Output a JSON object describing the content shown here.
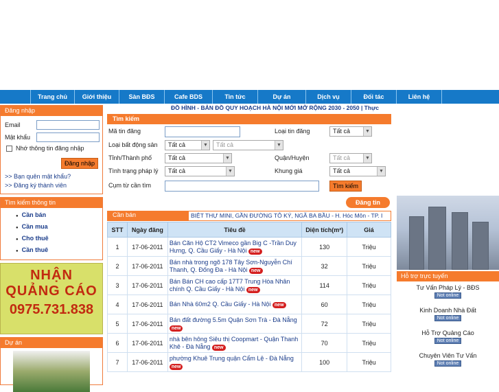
{
  "nav": [
    "Trang chủ",
    "Giới thiệu",
    "Sàn BĐS",
    "Cafe BDS",
    "Tin tức",
    "Dự án",
    "Dịch vụ",
    "Đối tác",
    "Liên hệ"
  ],
  "login": {
    "header": "Đăng nhập",
    "email_label": "Email",
    "password_label": "Mật khẩu",
    "remember_label": "Nhớ thông tin đăng nhập",
    "submit_label": "Đăng nhập",
    "forgot_link": ">> Bạn quên mật khẩu?",
    "register_link": ">> Đăng ký thành viên"
  },
  "search_info": {
    "header": "Tìm kiếm thông tin",
    "items": [
      "Cần bán",
      "Cần mua",
      "Cho thuê",
      "Cần thuê"
    ]
  },
  "ad": {
    "line1": "NHẬN",
    "line2": "QUẢNG CÁO",
    "phone": "0975.731.838"
  },
  "project_box": {
    "header": "Dự án"
  },
  "marquee": "ĐỒ HÌNH - BẢN ĐỒ QUY HOẠCH HÀ NỘI MỚI MỞ RỘNG 2030 - 2050 | Thực",
  "search": {
    "header": "Tìm kiếm",
    "code_label": "Mã tin đăng",
    "type_label": "Loại tin đăng",
    "type_value": "Tất cả",
    "property_label": "Loại bất động sản",
    "property_value": "Tất cả",
    "property_sub_value": "Tất cả",
    "province_label": "Tỉnh/Thành phố",
    "province_value": "Tất cả",
    "district_label": "Quận/Huyện",
    "district_value": "Tất cả",
    "legal_label": "Tình trạng pháp lý",
    "legal_value": "Tất cả",
    "price_label": "Khung giá",
    "price_value": "Tất cả",
    "keyword_label": "Cụm từ cần tìm",
    "search_button": "Tìm kiếm",
    "post_button": "Đăng tin"
  },
  "listing": {
    "tag": "Cần bán",
    "ticker": "BIỆT THỰ MINI, GẦN ĐƯỜNG TÔ KÝ, NGÃ BA BẦU - H. Hóc Môn - TP. I",
    "columns": [
      "STT",
      "Ngày đăng",
      "Tiêu đề",
      "Diện tích(m²)",
      "Giá"
    ],
    "new_badge": "new",
    "rows": [
      {
        "stt": "1",
        "date": "17-06-2011",
        "title": "Bán Căn Hộ CT2 Vimeco gần Big C -Trần Duy Hưng, Q. Cầu Giấy - Hà Nội",
        "area": "130",
        "price": "Triệu"
      },
      {
        "stt": "2",
        "date": "17-06-2011",
        "title": "Bán nhà trong ngõ 178 Tây Sơn-Nguyễn Chí Thanh, Q. Đống Đa - Hà Nội",
        "area": "32",
        "price": "Triệu"
      },
      {
        "stt": "3",
        "date": "17-06-2011",
        "title": "Bán Bán CH cao cấp 17T7 Trung Hòa Nhân chính Q. Cầu Giấy - Hà Nội",
        "area": "114",
        "price": "Triệu"
      },
      {
        "stt": "4",
        "date": "17-06-2011",
        "title": "Bán Nhà 60m2 Q. Cầu Giấy - Hà Nội",
        "area": "60",
        "price": "Triệu"
      },
      {
        "stt": "5",
        "date": "17-06-2011",
        "title": "Bán đất đường 5.5m Quận Sơn Trà - Đà Nẵng",
        "area": "72",
        "price": "Triệu"
      },
      {
        "stt": "6",
        "date": "17-06-2011",
        "title": "nhà bên hông Siêu thị Coopmart - Quận Thanh Khê - Đà Nẵng",
        "area": "70",
        "price": "Triệu"
      },
      {
        "stt": "7",
        "date": "17-06-2011",
        "title": "phường Khuê Trung quận Cẩm Lệ - Đà Nẵng",
        "area": "100",
        "price": "Triệu"
      }
    ]
  },
  "support": {
    "header": "Hỗ trợ trực tuyến",
    "status": "Not online",
    "items": [
      "Tư Vấn Pháp Lý - BĐS",
      "Kinh Doanh Nhà Đất",
      "Hỗ Trợ Quảng Cáo",
      "Chuyên Viên Tư Vấn"
    ]
  }
}
